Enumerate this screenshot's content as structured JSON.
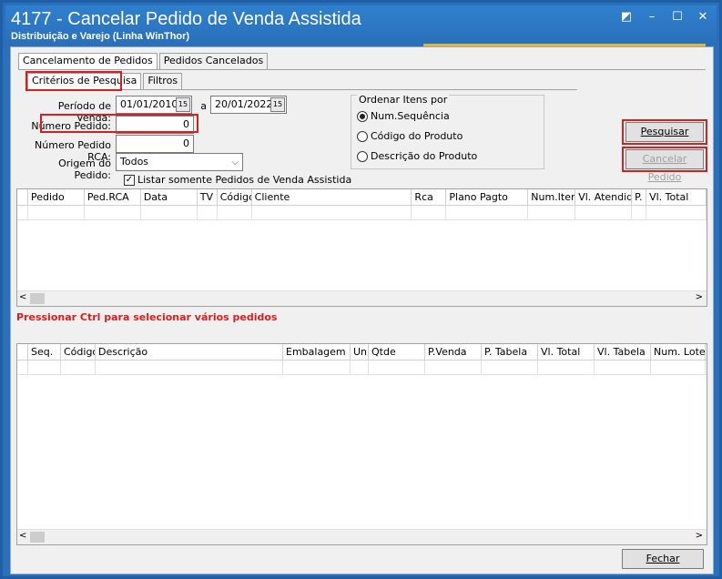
{
  "window": {
    "title": "4177 - Cancelar Pedido de Venda Assistida",
    "subtitle": "Distribuição e Varejo (Linha WinThor)"
  },
  "tabs_outer": [
    "Cancelamento de Pedidos",
    "Pedidos Cancelados"
  ],
  "tabs_inner": [
    "Critérios de Pesquisa",
    "Filtros"
  ],
  "form": {
    "periodo_label": "Período de Venda:",
    "data_inicio": "01/01/2010",
    "a_label": "a",
    "data_fim": "20/01/2022",
    "numero_pedido_label": "Número Pedido:",
    "numero_pedido_value": "0",
    "numero_pedido_rca_label": "Número Pedido RCA:",
    "numero_pedido_rca_value": "0",
    "origem_label": "Origem do Pedido:",
    "origem_value": "Todos",
    "listar_label": "Listar somente Pedidos de Venda Assistida",
    "listar_checked": true
  },
  "ordenar": {
    "title": "Ordenar Itens por",
    "options": [
      "Num.Sequência",
      "Código do Produto",
      "Descrição do Produto"
    ],
    "selected": "Num.Sequência"
  },
  "buttons": {
    "pesquisar": "Pesquisar",
    "cancelar_pedido": "Cancelar Pedido",
    "fechar": "Fechar"
  },
  "grid_pedidos": {
    "columns": [
      "Pedido",
      "Ped.RCA",
      "Data",
      "TV",
      "Código",
      "Cliente",
      "Rca",
      "Plano Pagto",
      "Num.Itens",
      "Vl. Atendido",
      "P.",
      "Vl. Total"
    ]
  },
  "warning": "Pressionar Ctrl para selecionar vários pedidos",
  "grid_itens": {
    "columns": [
      "Seq.",
      "Código",
      "Descrição",
      "Embalagem",
      "Un.",
      "Qtde",
      "P.Venda",
      "P. Tabela",
      "Vl. Total",
      "Vl. Tabela",
      "Num. Lote"
    ]
  },
  "colors": {
    "title_bar": "#2a6fb8",
    "highlight": "#d42020",
    "accent": "#e0b53a"
  }
}
